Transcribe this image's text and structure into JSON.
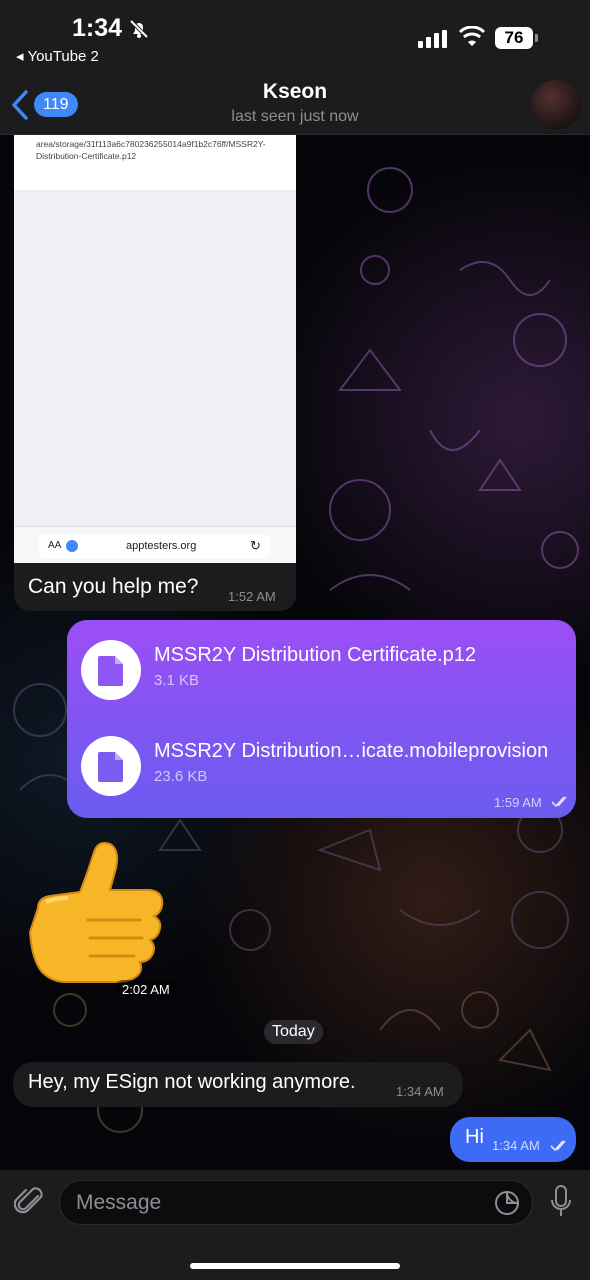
{
  "status_bar": {
    "time": "1:34",
    "back_app": "YouTube 2",
    "battery": "76"
  },
  "header": {
    "back_count": "119",
    "title": "Kseon",
    "subtitle": "last seen just now"
  },
  "messages": {
    "screenshot": {
      "url_text": "area/storage/31f113a6c780236255014a9f1b2c76ff/MSSR2Y-Distribution-Certificate.p12",
      "aa": "AA",
      "domain": "apptesters.org",
      "caption": "Can you help me?",
      "time": "1:52 AM"
    },
    "files": {
      "items": [
        {
          "name": "MSSR2Y Distribution Certificate.p12",
          "size": "3.1 KB"
        },
        {
          "name": "MSSR2Y Distribution…icate.mobileprovision",
          "size": "23.6 KB"
        }
      ],
      "time": "1:59 AM"
    },
    "thumbs": {
      "time": "2:02 AM"
    },
    "date_divider": "Today",
    "incoming": {
      "text": "Hey, my ESign not working anymore.",
      "time": "1:34 AM"
    },
    "outgoing": {
      "text": "Hi",
      "time": "1:34 AM"
    }
  },
  "input": {
    "placeholder": "Message"
  },
  "colors": {
    "accent": "#3e88f7",
    "outgoing_gradient_top": "#9b4ef5",
    "outgoing_gradient_bottom": "#6a5cf0",
    "outgoing_plain": "#3e6bf5",
    "incoming": "#1c1c1e"
  },
  "icons": [
    "bell-slash-icon",
    "signal-icon",
    "wifi-icon",
    "back-chevron-icon",
    "file-icon",
    "double-check-icon",
    "paperclip-icon",
    "sticker-icon",
    "microphone-icon"
  ]
}
